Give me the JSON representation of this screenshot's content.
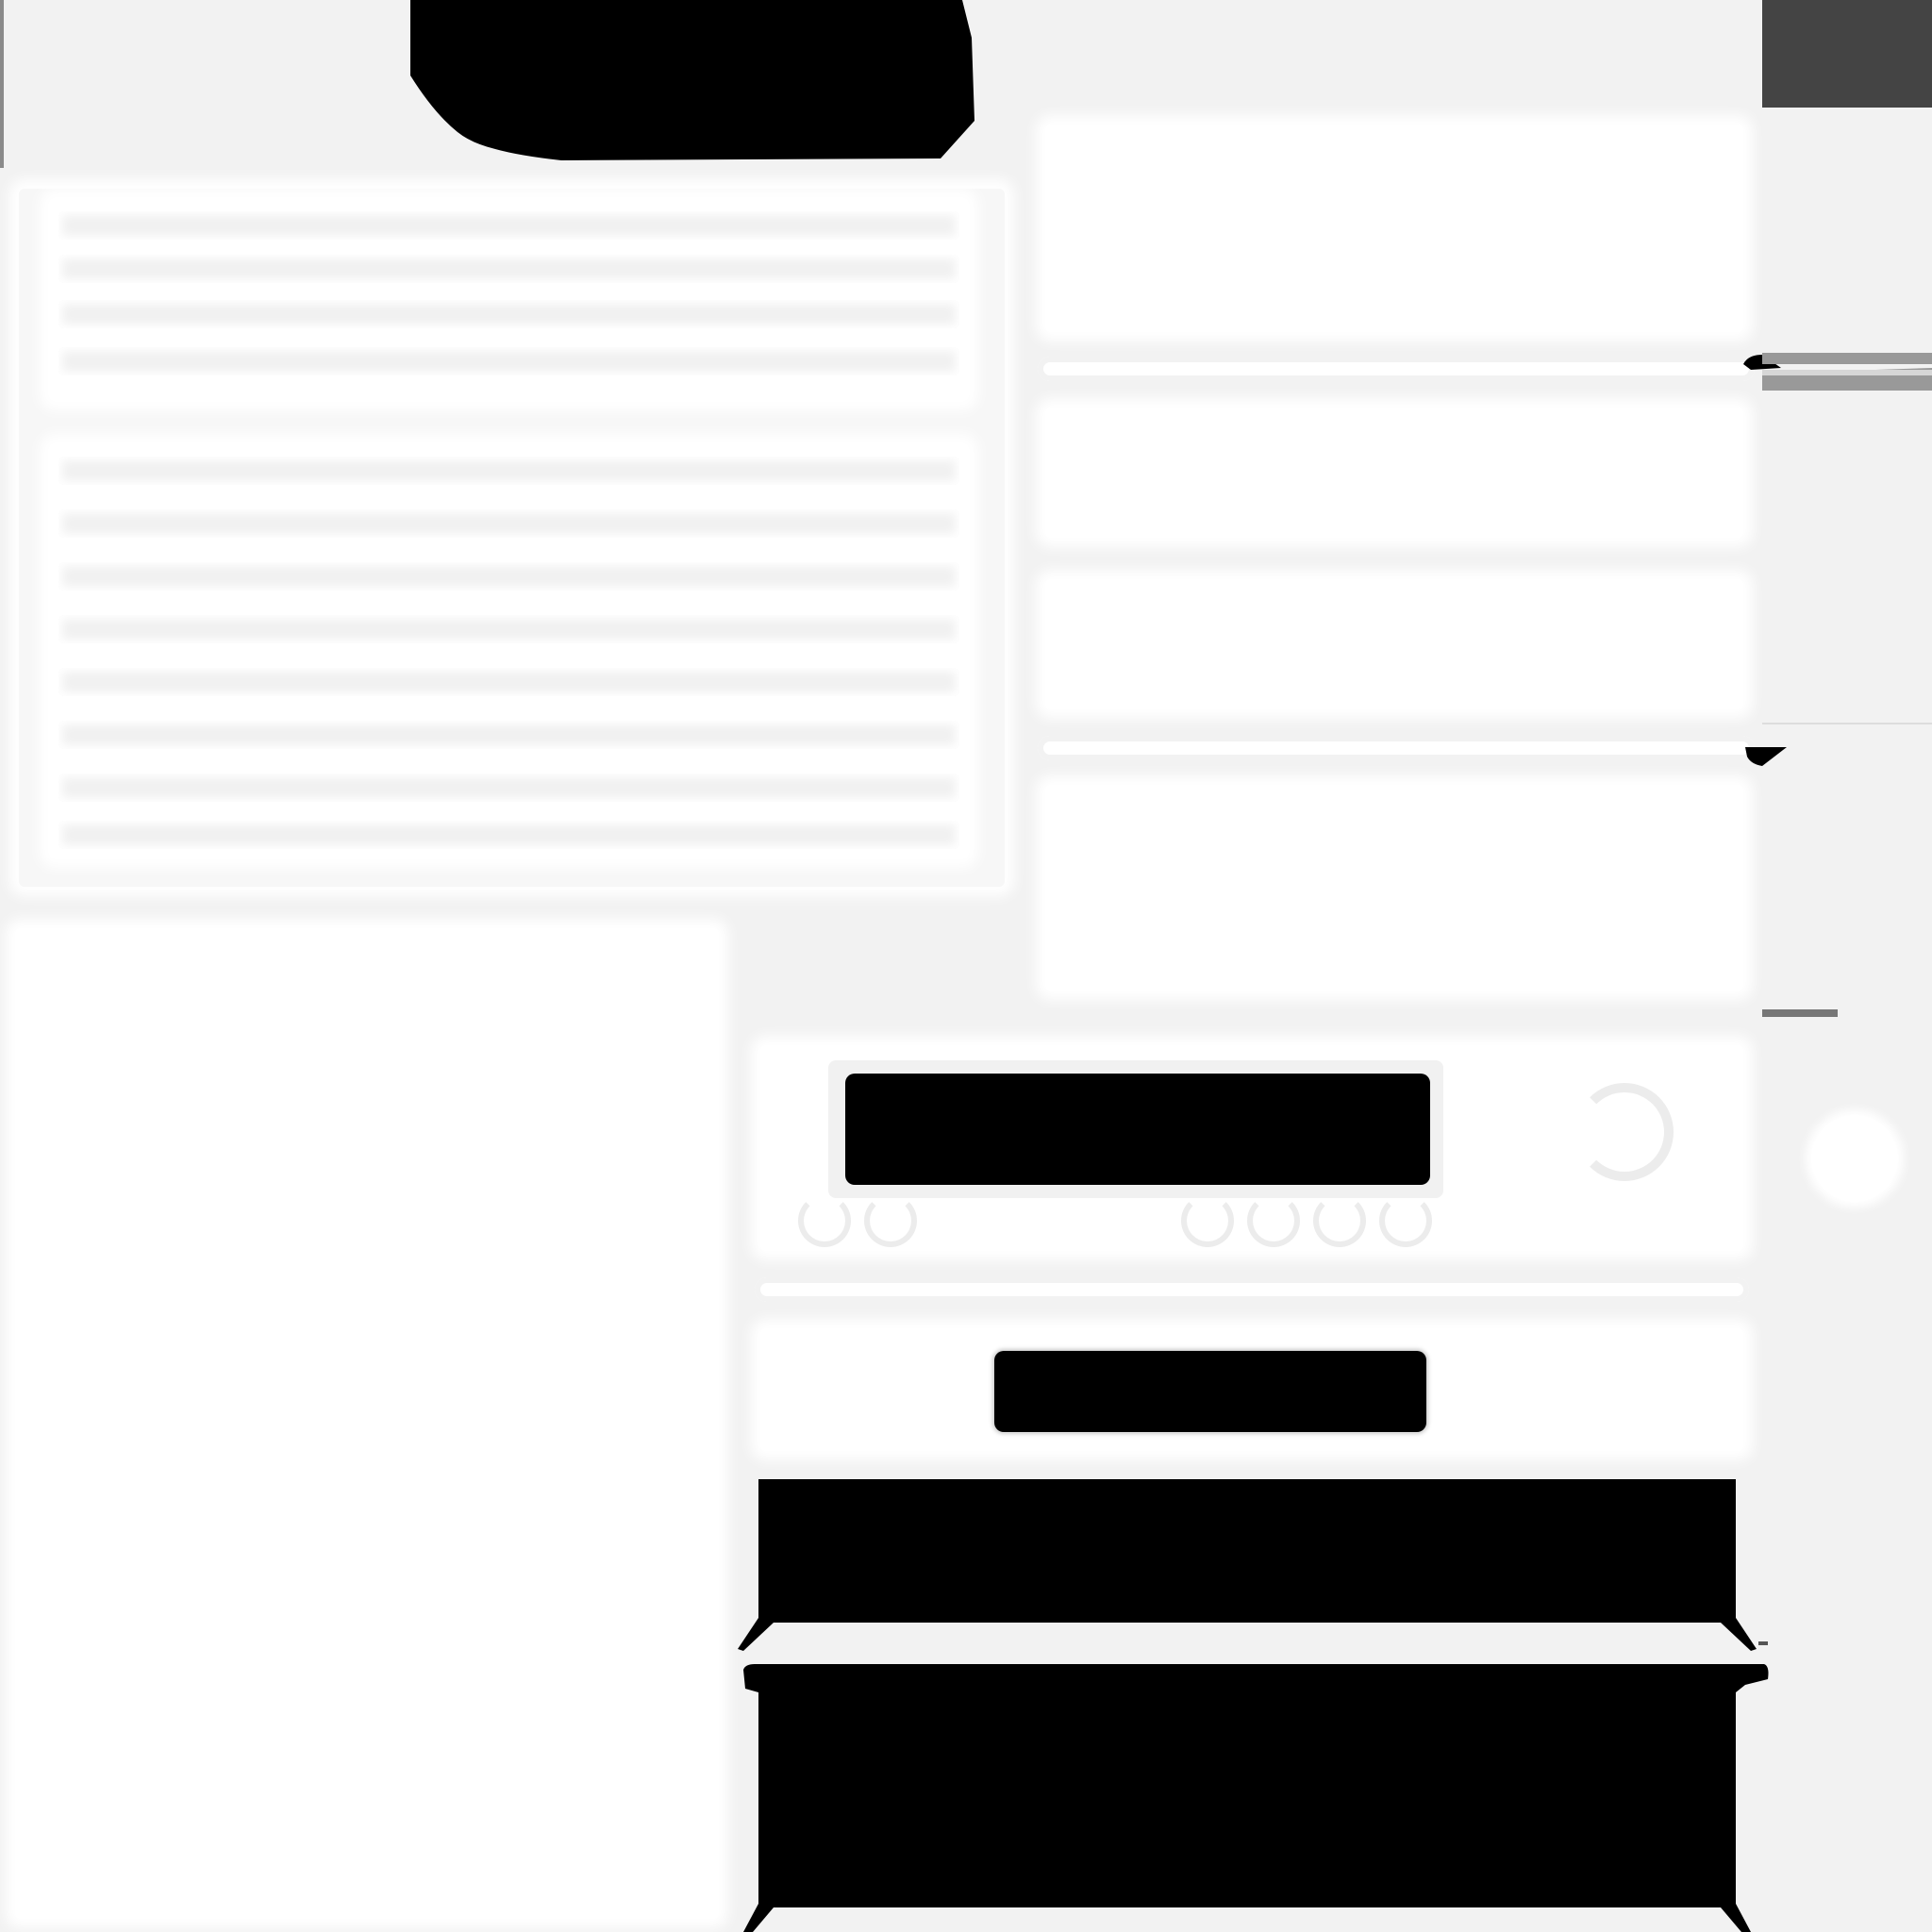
{
  "texture": {
    "background_color": "#f2f2f2",
    "panel_color": "#ffffff",
    "shape_color": "#000000",
    "accent_dark": "#444444",
    "accent_mid": "#999999"
  }
}
